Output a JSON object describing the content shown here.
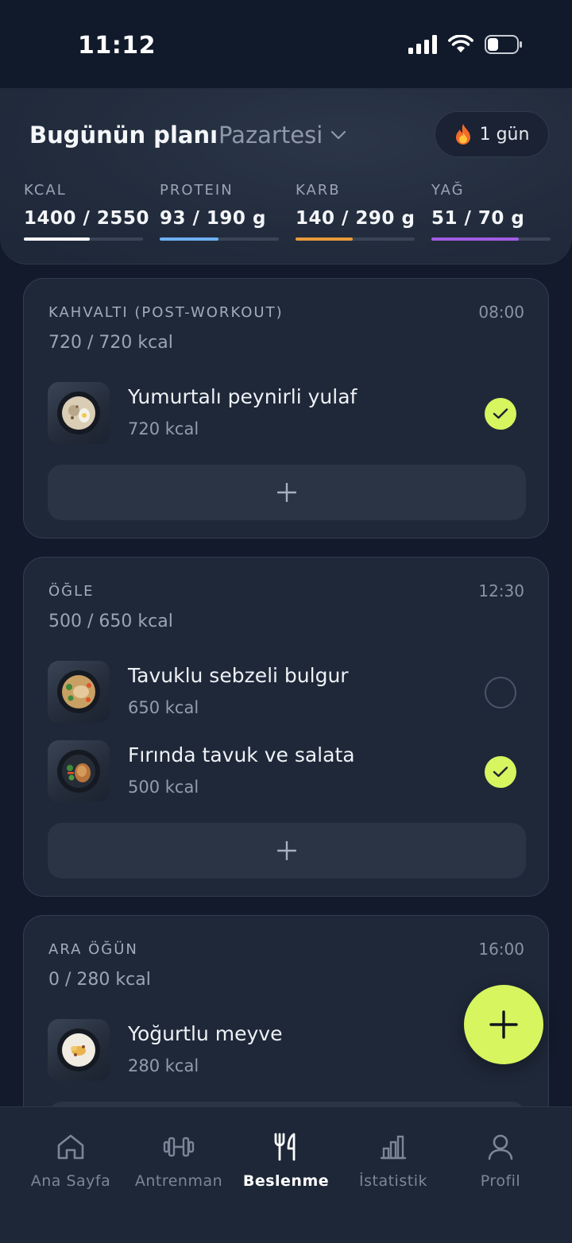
{
  "status": {
    "time": "11:12"
  },
  "header": {
    "title": "Bugünün planı",
    "day": "Pazartesi",
    "streak": "1 gün",
    "macros": [
      {
        "label": "KCAL",
        "value": "1400 / 2550",
        "progress": 0.55,
        "color": "#ffffff"
      },
      {
        "label": "PROTEIN",
        "value": "93 / 190 g",
        "progress": 0.49,
        "color": "#6fb0f2"
      },
      {
        "label": "KARB",
        "value": "140 / 290 g",
        "progress": 0.48,
        "color": "#e99a3a"
      },
      {
        "label": "YAĞ",
        "value": "51 / 70 g",
        "progress": 0.73,
        "color": "#a35de3"
      }
    ]
  },
  "meals": [
    {
      "name": "KAHVALTI (POST-WORKOUT)",
      "time": "08:00",
      "kcal": "720 / 720 kcal",
      "foods": [
        {
          "name": "Yumurtalı peynirli yulaf",
          "kcal": "720 kcal",
          "done": true
        }
      ]
    },
    {
      "name": "ÖĞLE",
      "time": "12:30",
      "kcal": "500 / 650 kcal",
      "foods": [
        {
          "name": "Tavuklu sebzeli bulgur",
          "kcal": "650 kcal",
          "done": false
        },
        {
          "name": "Fırında tavuk ve salata",
          "kcal": "500 kcal",
          "done": true
        }
      ]
    },
    {
      "name": "ARA ÖĞÜN",
      "time": "16:00",
      "kcal": "0 / 280 kcal",
      "foods": [
        {
          "name": "Yoğurtlu meyve",
          "kcal": "280 kcal",
          "done": false
        }
      ]
    }
  ],
  "nav": [
    {
      "label": "Ana Sayfa",
      "icon": "home-icon",
      "active": false
    },
    {
      "label": "Antrenman",
      "icon": "dumbbell-icon",
      "active": false
    },
    {
      "label": "Beslenme",
      "icon": "fork-knife-icon",
      "active": true
    },
    {
      "label": "İstatistik",
      "icon": "bar-chart-icon",
      "active": false
    },
    {
      "label": "Profil",
      "icon": "user-icon",
      "active": false
    }
  ],
  "colors": {
    "accent": "#d6f55f",
    "background": "#121a2b",
    "card": "#1f2839"
  }
}
